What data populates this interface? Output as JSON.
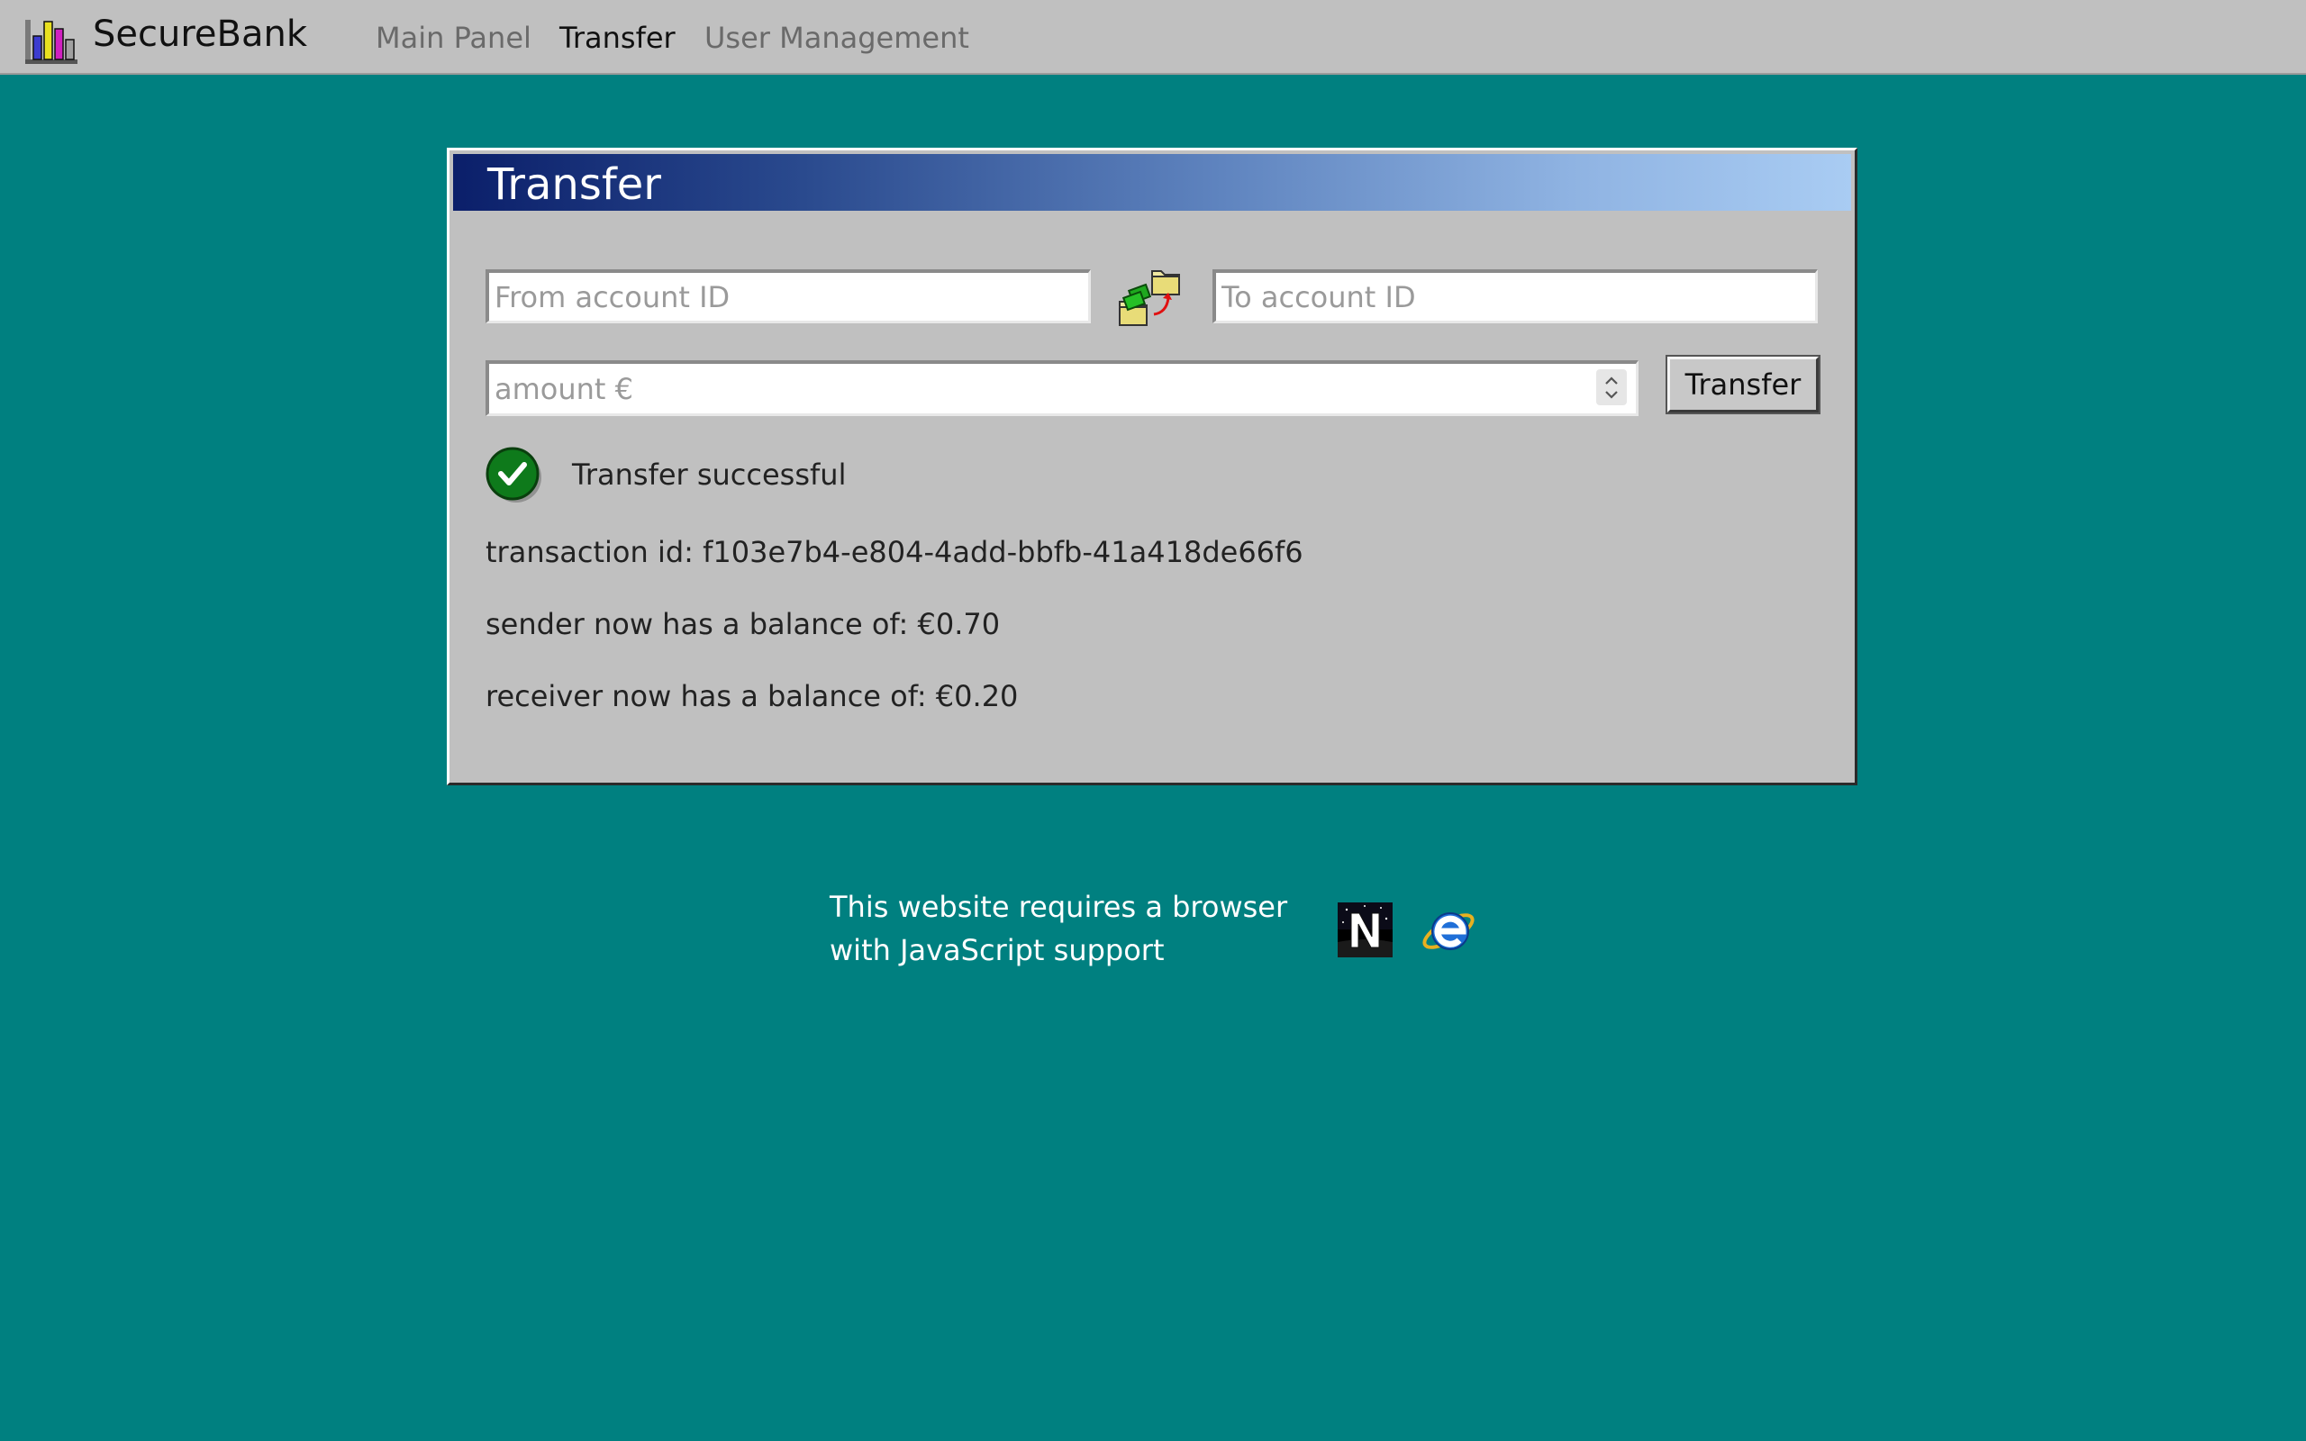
{
  "brand": {
    "name": "SecureBank",
    "logo_icon": "bar-chart-logo-icon"
  },
  "nav": {
    "items": [
      {
        "label": "Main Panel",
        "active": false
      },
      {
        "label": "Transfer",
        "active": true
      },
      {
        "label": "User Management",
        "active": false
      }
    ]
  },
  "panel": {
    "title": "Transfer",
    "from_placeholder": "From account ID",
    "from_value": "",
    "to_placeholder": "To account ID",
    "to_value": "",
    "amount_placeholder": "amount €",
    "amount_value": "",
    "swap_icon": "swap-accounts-icon",
    "submit_label": "Transfer"
  },
  "result": {
    "status_icon": "checkmark-icon",
    "status_text": "Transfer successful",
    "transaction_line": "transaction id: f103e7b4-e804-4add-bbfb-41a418de66f6",
    "sender_line": "sender now has a balance of: €0.70",
    "receiver_line": "receiver now has a balance of: €0.20"
  },
  "footer": {
    "line1": "This website requires a browser",
    "line2": "with JavaScript support",
    "icons": [
      "netscape-icon",
      "internet-explorer-icon"
    ]
  },
  "colors": {
    "desktop": "#008080",
    "window": "#c0c0c0",
    "titlebar_start": "#0b1f6a",
    "titlebar_end": "#a9ccf3",
    "success": "#0e7a1b"
  }
}
